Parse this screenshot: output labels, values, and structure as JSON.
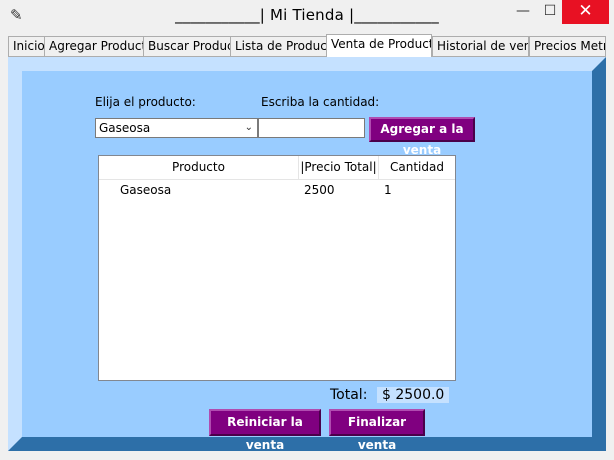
{
  "window": {
    "title": "___________| Mi Tienda |___________",
    "feather_icon": "✎",
    "min_icon": "—",
    "max_icon": "☐",
    "close_icon": "✕"
  },
  "tabs": [
    {
      "label": "Inicio"
    },
    {
      "label": "Agregar Producto"
    },
    {
      "label": "Buscar Producto"
    },
    {
      "label": "Lista de Productos"
    },
    {
      "label": "Venta de Producto"
    },
    {
      "label": "Historial de ventas"
    },
    {
      "label": "Precios Metr"
    }
  ],
  "active_tab": "Venta de Producto",
  "form": {
    "product_label": "Elija el producto:",
    "product_value": "Gaseosa",
    "quantity_label": "Escriba la cantidad:",
    "quantity_value": "",
    "add_button": "Agregar a la venta"
  },
  "table": {
    "columns": [
      "Producto",
      "|Precio Total|",
      "Cantidad"
    ],
    "rows": [
      {
        "producto": "Gaseosa",
        "precio_total": "2500",
        "cantidad": "1"
      }
    ]
  },
  "total": {
    "label": "Total:",
    "value": "$ 2500.0"
  },
  "buttons": {
    "reset": "Reiniciar la venta",
    "finish": "Finalizar venta"
  },
  "colors": {
    "panel_bg": "#99ccff",
    "button_bg": "#800080",
    "close_red": "#e81123"
  }
}
